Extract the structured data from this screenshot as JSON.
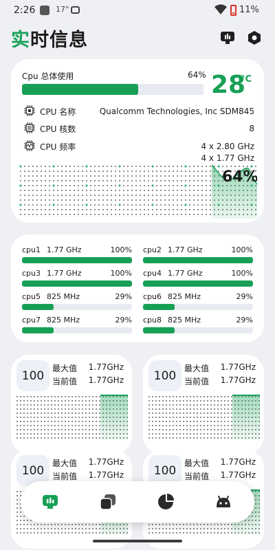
{
  "status_bar": {
    "time": "2:26",
    "temperature": "17°",
    "battery": "11%"
  },
  "header": {
    "title_accent": "实",
    "title_rest": "时信息"
  },
  "overview": {
    "cpu_label": "Cpu 总体使用",
    "cpu_percent_text": "64%",
    "cpu_usage": 0.64,
    "temperature": "28",
    "temperature_unit": "°C",
    "graph_label": "64%",
    "rows": [
      {
        "key": "CPU 名称",
        "value": "Qualcomm Technologies, Inc SDM845",
        "icon": "chip-icon"
      },
      {
        "key": "CPU 核数",
        "value": "8",
        "icon": "chip-cores-icon"
      },
      {
        "key": "CPU 频率",
        "value_line1": "4 x 2.80 GHz",
        "value_line2": "4 x 1.77 GHz",
        "icon": "frequency-icon"
      }
    ]
  },
  "cores": [
    {
      "name": "cpu1",
      "freq": "1.77 GHz",
      "percent": "100%",
      "usage": 1.0
    },
    {
      "name": "cpu2",
      "freq": "1.77 GHz",
      "percent": "100%",
      "usage": 1.0
    },
    {
      "name": "cpu3",
      "freq": "1.77 GHz",
      "percent": "100%",
      "usage": 1.0
    },
    {
      "name": "cpu4",
      "freq": "1.77 GHz",
      "percent": "100%",
      "usage": 1.0
    },
    {
      "name": "cpu5",
      "freq": "825 MHz",
      "percent": "29%",
      "usage": 0.29
    },
    {
      "name": "cpu6",
      "freq": "825 MHz",
      "percent": "29%",
      "usage": 0.29
    },
    {
      "name": "cpu7",
      "freq": "825 MHz",
      "percent": "29%",
      "usage": 0.29
    },
    {
      "name": "cpu8",
      "freq": "825 MHz",
      "percent": "29%",
      "usage": 0.29
    }
  ],
  "freq_cards": [
    {
      "badge": "100",
      "max_label": "最大值",
      "max_value": "1.77GHz",
      "cur_label": "当前值",
      "cur_value": "1.77GHz"
    },
    {
      "badge": "100",
      "max_label": "最大值",
      "max_value": "1.77GHz",
      "cur_label": "当前值",
      "cur_value": "1.77GHz"
    },
    {
      "badge": "100",
      "max_label": "最大值",
      "max_value": "1.77GHz",
      "cur_label": "当前值",
      "cur_value": "1.77GHz"
    },
    {
      "badge": "100",
      "max_label": "最大值",
      "max_value": "1.77GHz",
      "cur_label": "当前值",
      "cur_value": "1.77GHz"
    }
  ],
  "nav": [
    {
      "icon": "realtime-info-icon",
      "active": true
    },
    {
      "icon": "layers-icon",
      "active": false
    },
    {
      "icon": "pie-chart-icon",
      "active": false
    },
    {
      "icon": "android-icon",
      "active": false
    }
  ],
  "colors": {
    "accent": "#17a055",
    "background": "#eef0f4",
    "card": "#ffffff",
    "track": "#e7eaf0"
  }
}
